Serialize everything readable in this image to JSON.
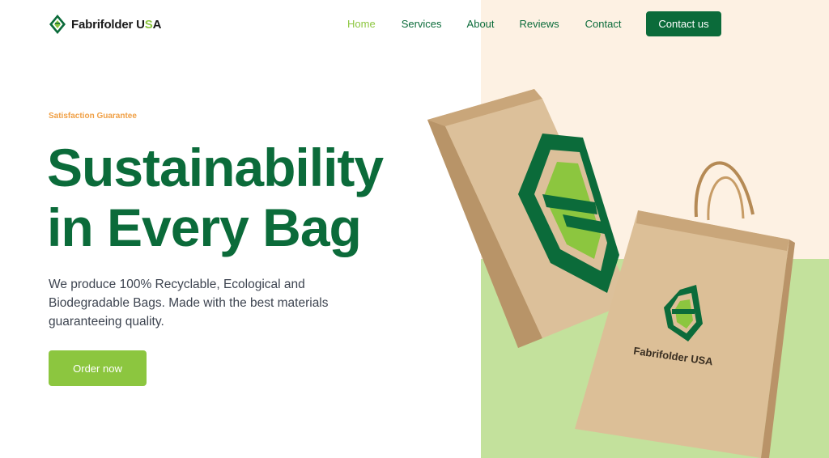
{
  "brand": {
    "name_part": "Fabrifolder U",
    "name_accent": "S",
    "name_tail": "A",
    "logo_icon": "leaf-f-logo-icon",
    "colors": {
      "primary": "#0b6b3a",
      "accent": "#8cc63f",
      "eyebrow": "#f0a046"
    }
  },
  "nav": {
    "items": [
      {
        "label": "Home",
        "active": true
      },
      {
        "label": "Services",
        "active": false
      },
      {
        "label": "About",
        "active": false
      },
      {
        "label": "Reviews",
        "active": false
      },
      {
        "label": "Contact",
        "active": false
      }
    ],
    "cta_label": "Contact us"
  },
  "hero": {
    "eyebrow": "Satisfaction Guarantee",
    "title_line1": "Sustainability",
    "title_line2": "in Every Bag",
    "description": "We produce 100% Recyclable, Ecological and Biodegradable Bags. Made with the best materials guaranteeing quality.",
    "order_label": "Order now"
  },
  "illustration": {
    "bag_print": "Fabrifolder USA"
  }
}
